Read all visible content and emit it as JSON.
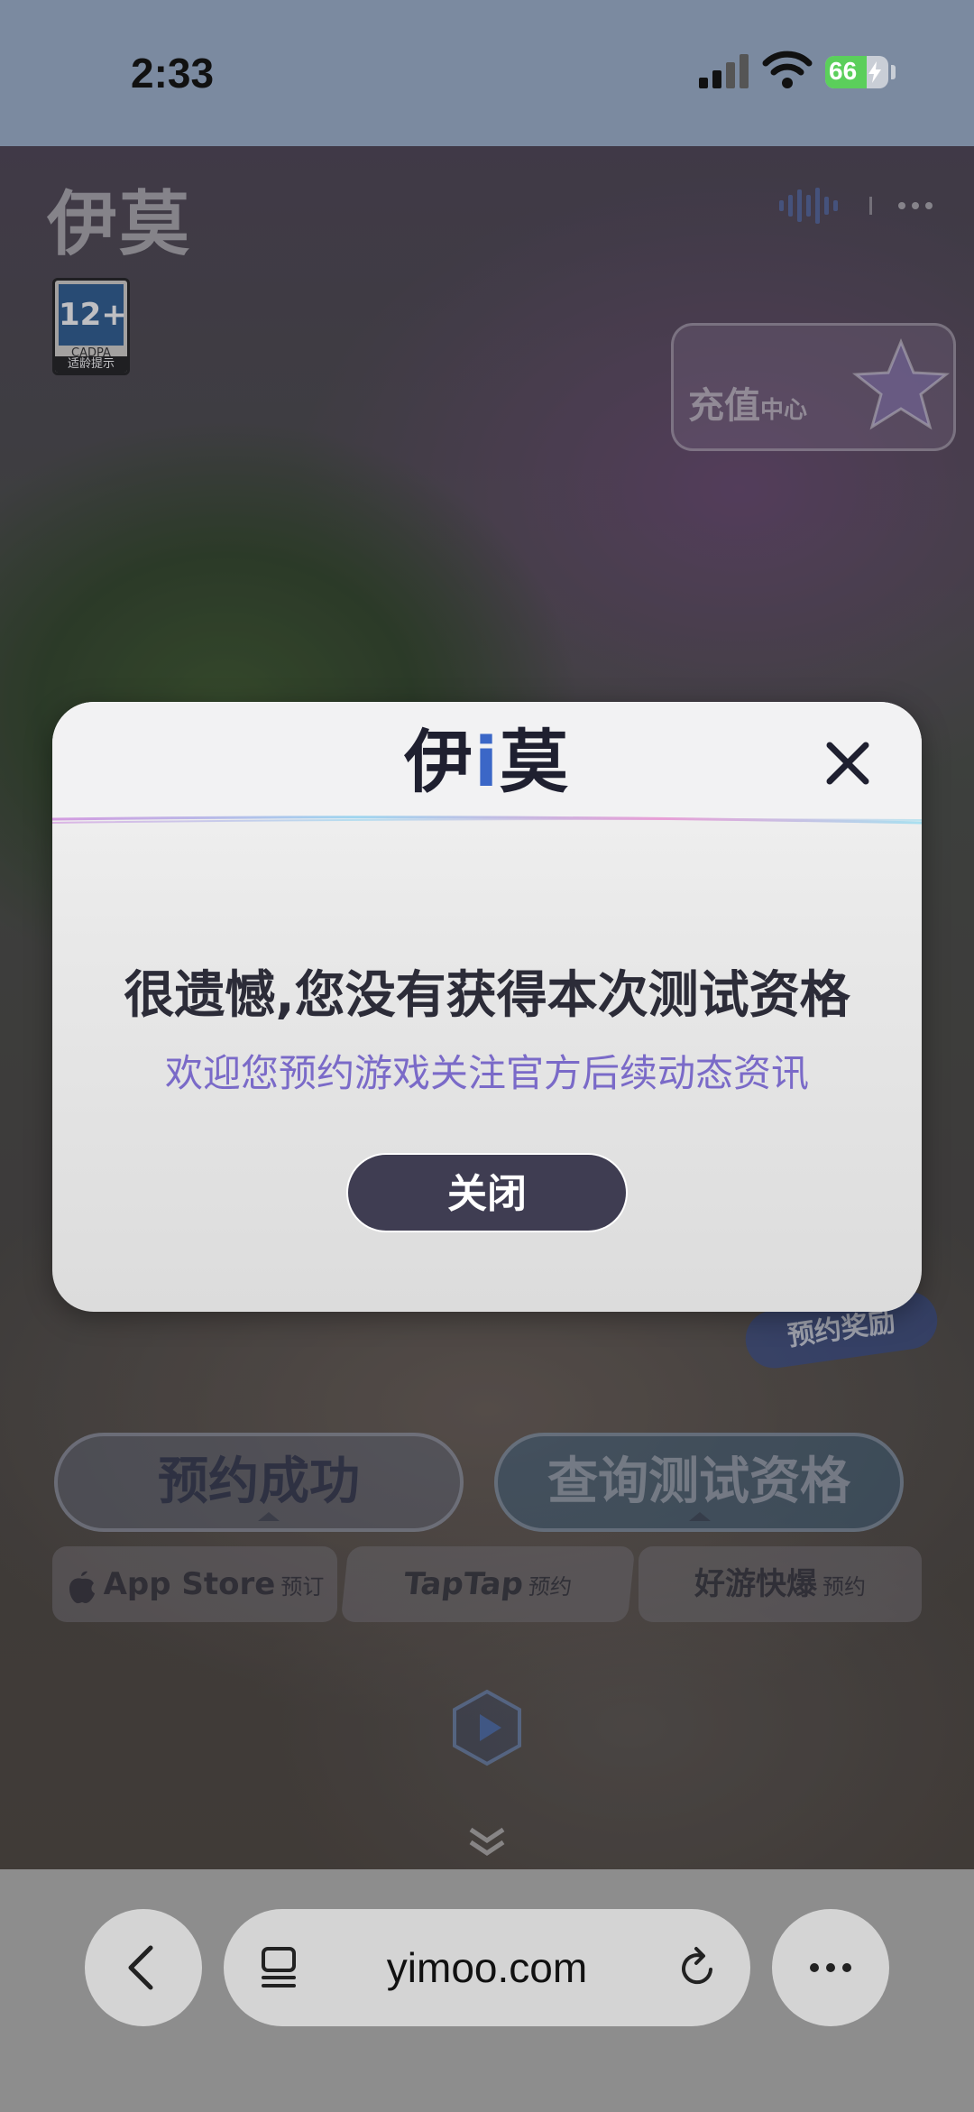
{
  "status_bar": {
    "time": "2:33",
    "battery_level": "66",
    "battery_color": "#5bcf5b",
    "icons": [
      "signal-icon",
      "wifi-icon",
      "battery-icon",
      "charging-bolt-icon"
    ]
  },
  "page": {
    "brand_logo": "伊莫",
    "age_rating": {
      "value": "12+",
      "org": "CADPA",
      "caption": "适龄提示"
    },
    "recharge_card": {
      "title": "充值",
      "subtitle": "中心"
    },
    "sticker": "预约奖励",
    "primary_buttons": [
      {
        "label": "预约成功"
      },
      {
        "label": "查询测试资格"
      }
    ],
    "store_buttons": [
      {
        "name": "App Store",
        "action": "预订"
      },
      {
        "name": "TapTap",
        "action": "预约"
      },
      {
        "name": "好游快爆",
        "action": "预约"
      }
    ]
  },
  "modal": {
    "logo": {
      "left": "伊",
      "mid": "i",
      "right": "莫"
    },
    "title": "很遗憾,您没有获得本次测试资格",
    "subtitle": "欢迎您预约游戏关注官方后续动态资讯",
    "button_label": "关闭",
    "accent_color": "#7a6ac8",
    "button_color": "#3f3d52"
  },
  "browser_bar": {
    "url": "yimoo.com",
    "icons": [
      "back-chevron-icon",
      "tabs-icon",
      "reload-icon",
      "more-icon"
    ]
  }
}
